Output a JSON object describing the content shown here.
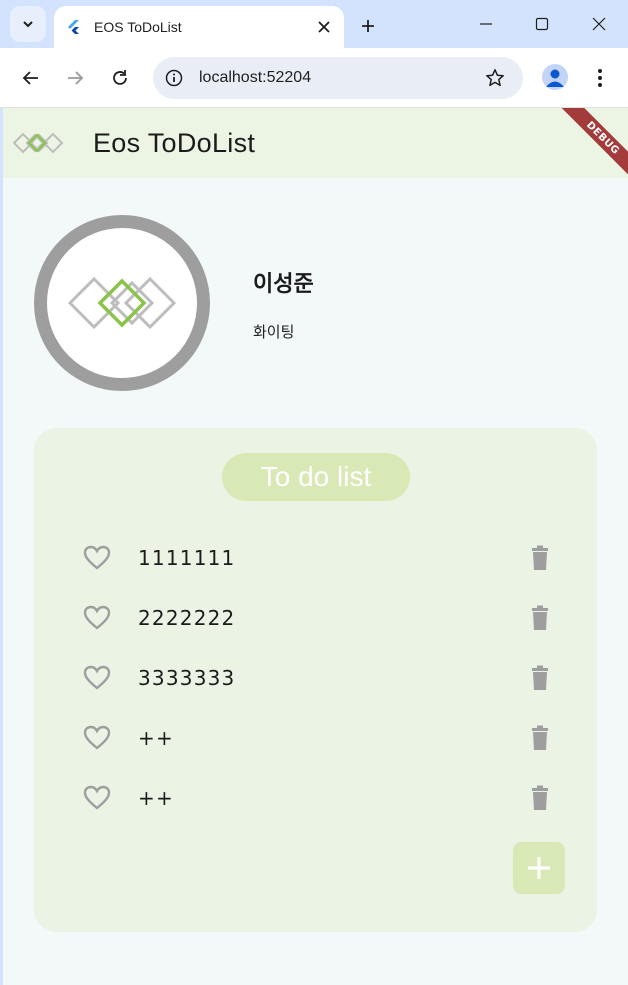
{
  "browser": {
    "tab_title": "EOS ToDoList",
    "url": "localhost:52204"
  },
  "app": {
    "title": "Eos ToDoList",
    "debug_label": "DEBUG",
    "profile": {
      "name": "이성준",
      "status": "화이팅"
    },
    "todo": {
      "header": "To do list",
      "items": [
        {
          "text": "1111111"
        },
        {
          "text": "2222222"
        },
        {
          "text": "3333333"
        },
        {
          "text": "++"
        },
        {
          "text": "++"
        }
      ]
    }
  },
  "icons": {
    "tab_search": "chevron-down-icon",
    "tab_favicon": "flutter-icon",
    "tab_close": "close-icon",
    "new_tab": "plus-icon",
    "minimize": "minimize-icon",
    "maximize": "maximize-icon",
    "close_window": "close-icon",
    "back": "arrow-left-icon",
    "forward": "arrow-right-icon",
    "reload": "reload-icon",
    "site_info": "info-icon",
    "bookmark": "star-icon",
    "profile": "person-icon",
    "menu": "kebab-menu-icon",
    "favorite": "heart-outline-icon",
    "delete": "trash-icon",
    "add": "plus-icon"
  },
  "colors": {
    "appbar_bg": "#ecf5e4",
    "card_bg": "#ebf4e4",
    "accent_light": "#d8e9b5",
    "logo_green": "#8bc34a",
    "logo_gray": "#bdbdbd",
    "avatar_ring": "#9e9e9e",
    "icon_gray": "#9e9e9e"
  }
}
